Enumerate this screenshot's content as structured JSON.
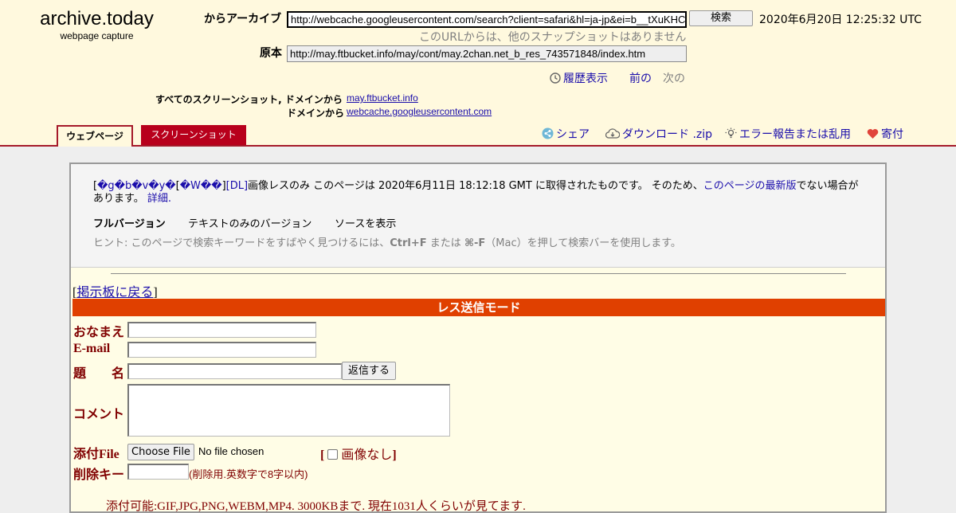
{
  "header": {
    "logo": "archive.today",
    "logo_sub": "webpage capture",
    "archive_from_label": "からアーカイブ",
    "archive_url": "http://webcache.googleusercontent.com/search?client=safari&hl=ja-jp&ei=b__tXuKHC",
    "search_button": "検索",
    "capture_date": "2020年6月20日 12:25:32 UTC",
    "no_other_snapshots": "このURLからは、他のスナップショットはありません",
    "original_label": "原本",
    "original_url": "http://may.ftbucket.info/may/cont/may.2chan.net_b_res_743571848/index.htm",
    "history": "履歴表示",
    "prev": "前の",
    "next": "次の",
    "all_screenshots_label": "すべてのスクリーンショット, ドメインから",
    "domain1": "may.ftbucket.info",
    "domain_label": "ドメインから",
    "domain2": "webcache.googleusercontent.com"
  },
  "tabs": {
    "webpage": "ウェブページ",
    "screenshot": "スクリーンショット"
  },
  "actions": {
    "share": "シェア",
    "download": "ダウンロード .zip",
    "report": "エラー報告または乱用",
    "donate": "寄付"
  },
  "info": {
    "bracket_open": "[",
    "garbled1": "�g�b�v�y�",
    "bracket_mid": "[",
    "garbled2": "�W��",
    "bracket_close": "]",
    "dl_link": "[DL]",
    "text1": "画像レスのみ このページは 2020年6月11日 18:12:18 GMT に取得されたものです。 そのため、",
    "latest_link": "このページの最新版",
    "text2": "でない場合があります。",
    "details_link": "詳細.",
    "full_version": "フルバージョン",
    "text_version": "テキストのみのバージョン",
    "view_source": "ソースを表示",
    "hint_prefix": "ヒント: このページで検索キーワードをすばやく見つけるには、",
    "hint_key1": "Ctrl+F",
    "hint_mid": " または ",
    "hint_key2": "⌘-F",
    "hint_suffix": "（Mac）を押して検索バーを使用します。"
  },
  "board": {
    "back_open": "[",
    "back_link": "掲示板に戻る",
    "back_close": "]",
    "mode_title": "レス送信モード",
    "name_label": "おなまえ",
    "email_label": "E-mail",
    "subject_label": "題　　名",
    "reply_button": "返信する",
    "comment_label": "コメント",
    "file_label": "添付File",
    "choose_file": "Choose File",
    "no_file": "No file chosen",
    "no_image_open": "[",
    "no_image": "画像なし",
    "no_image_close": "]",
    "delete_key_label": "削除キー",
    "delete_key_note": "(削除用.英数字で8字以内)",
    "footer_note": "添付可能:GIF,JPG,PNG,WEBM,MP4. 3000KBまで. 現在1031人くらいが見てます."
  },
  "colors": {
    "header_bg": "#fff9de",
    "accent": "#a51a2a",
    "tab_red": "#b8001c",
    "link": "#1a0dab",
    "mode_bar": "#e04000",
    "maroon": "#800000"
  }
}
